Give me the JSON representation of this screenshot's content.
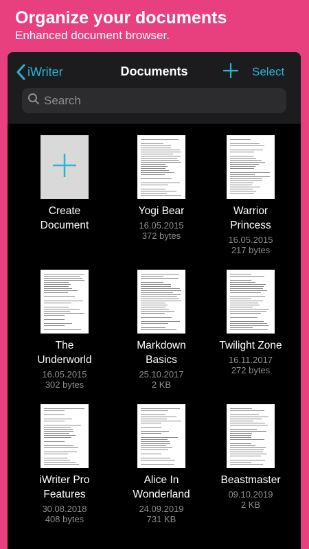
{
  "promo": {
    "title": "Organize your documents",
    "subtitle": "Enhanced document browser."
  },
  "navbar": {
    "back_label": "iWriter",
    "title": "Documents",
    "select_label": "Select",
    "accent_color": "#2AB3D6"
  },
  "search": {
    "placeholder": "Search"
  },
  "create": {
    "line1": "Create",
    "line2": "Document"
  },
  "documents": [
    {
      "line1": "Yogi Bear",
      "line2": "",
      "date": "16.05.2015",
      "size": "372 bytes"
    },
    {
      "line1": "Warrior",
      "line2": "Princess",
      "date": "16.05.2015",
      "size": "217 bytes"
    },
    {
      "line1": "The",
      "line2": "Underworld",
      "date": "16.05.2015",
      "size": "302 bytes"
    },
    {
      "line1": "Markdown",
      "line2": "Basics",
      "date": "25.10.2017",
      "size": "2 KB"
    },
    {
      "line1": "Twilight Zone",
      "line2": "",
      "date": "16.11.2017",
      "size": "272 bytes"
    },
    {
      "line1": "iWriter Pro",
      "line2": "Features",
      "date": "30.08.2018",
      "size": "408 bytes"
    },
    {
      "line1": "Alice In",
      "line2": "Wonderland",
      "date": "24.09.2019",
      "size": "731 KB"
    },
    {
      "line1": "Beastmaster",
      "line2": "",
      "date": "09.10.2019",
      "size": "2 KB"
    }
  ]
}
